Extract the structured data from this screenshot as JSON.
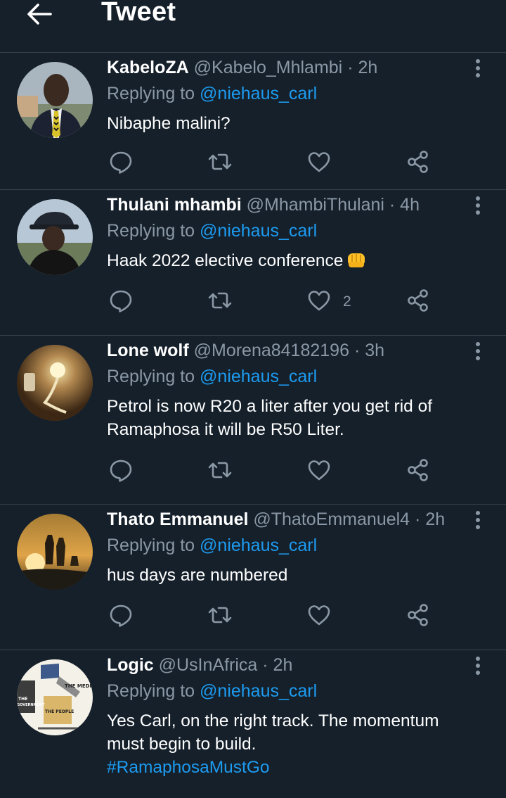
{
  "header": {
    "title": "Tweet",
    "back_icon": "arrow-left-icon"
  },
  "colors": {
    "background": "#15202b",
    "divider": "#38444d",
    "muted": "#8b98a5",
    "link": "#1d9bf0"
  },
  "tweets": [
    {
      "name": "KabeloZA",
      "handle": "@Kabelo_Mhlambi",
      "time": "2h",
      "replying_prefix": "Replying to",
      "replying_to": "@niehaus_carl",
      "text": "Nibaphe malini?",
      "like_count": ""
    },
    {
      "name": "Thulani mhambi",
      "handle": "@MhambiThulani",
      "time": "4h",
      "replying_prefix": "Replying to",
      "replying_to": "@niehaus_carl",
      "text": "Haak 2022 elective conference",
      "emoji": "oncoming-fist-icon",
      "like_count": "2"
    },
    {
      "name": "Lone wolf",
      "handle": "@Morena84182196",
      "time": "3h",
      "replying_prefix": "Replying to",
      "replying_to": "@niehaus_carl",
      "text_lines": [
        "Petrol is now R20 a liter after you get rid of",
        "Ramaphosa it will be R50 Liter."
      ],
      "like_count": ""
    },
    {
      "name": "Thato Emmanuel",
      "handle": "@ThatoEmmanuel4",
      "time": "2h",
      "replying_prefix": "Replying to",
      "replying_to": "@niehaus_carl",
      "text": "hus days are numbered",
      "like_count": ""
    },
    {
      "name": "Logic",
      "handle": "@UsInAfrica",
      "time": "2h",
      "replying_prefix": "Replying to",
      "replying_to": "@niehaus_carl",
      "text_lines": [
        "Yes Carl, on the right track. The momentum",
        "must begin to build."
      ],
      "hashtag": "#RamaphosaMustGo",
      "avatar_labels": [
        "THE MEDIA",
        "THE GOVERNMENT",
        "THE PEOPLE"
      ]
    }
  ],
  "dot": "·"
}
